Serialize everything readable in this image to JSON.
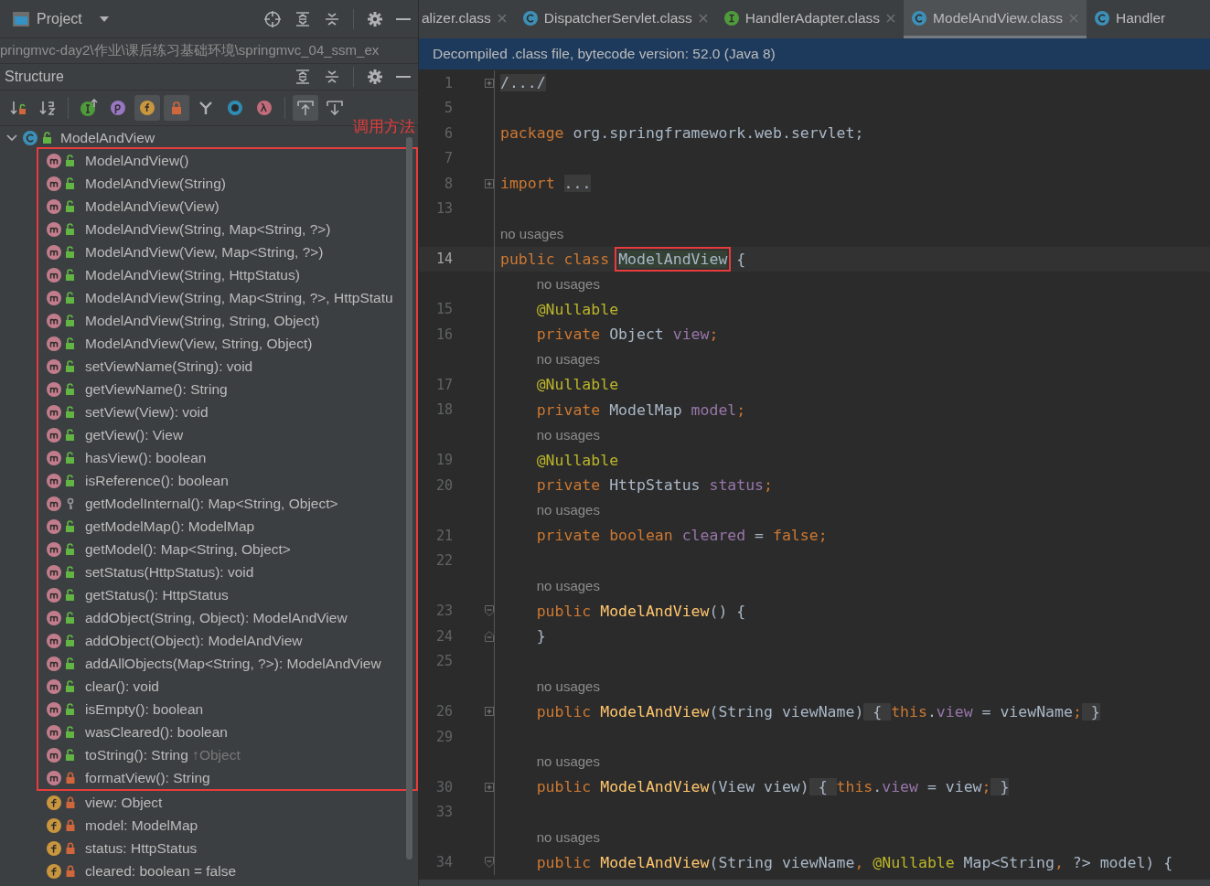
{
  "project_panel": {
    "title": "Project",
    "path": "pringmvc-day2\\作业\\课后练习基础环境\\springmvc_04_ssm_ex"
  },
  "structure_panel": {
    "title": "Structure",
    "toolbar": [
      {
        "kind": "sort-visibility",
        "on": false
      },
      {
        "kind": "sort-alpha",
        "on": false
      },
      {
        "kind": "sep"
      },
      {
        "kind": "inherited",
        "on": false
      },
      {
        "kind": "properties",
        "on": false
      },
      {
        "kind": "fields",
        "on": true
      },
      {
        "kind": "non-public",
        "on": true
      },
      {
        "kind": "fork",
        "on": false
      },
      {
        "kind": "anonymous",
        "on": false
      },
      {
        "kind": "lambdas",
        "on": false
      },
      {
        "kind": "sep"
      },
      {
        "kind": "expand-from",
        "on": true
      },
      {
        "kind": "expand-to",
        "on": false
      }
    ],
    "annotation": {
      "text": "调用方法",
      "kind": "methods"
    },
    "tree": {
      "label": "ModelAndView",
      "kind": "public-class",
      "expanded": true,
      "children": [
        {
          "label": "ModelAndView()",
          "kind": "public-method"
        },
        {
          "label": "ModelAndView(String)",
          "kind": "public-method"
        },
        {
          "label": "ModelAndView(View)",
          "kind": "public-method"
        },
        {
          "label": "ModelAndView(String, Map<String, ?>)",
          "kind": "public-method"
        },
        {
          "label": "ModelAndView(View, Map<String, ?>)",
          "kind": "public-method"
        },
        {
          "label": "ModelAndView(String, HttpStatus)",
          "kind": "public-method"
        },
        {
          "label": "ModelAndView(String, Map<String, ?>, HttpStatu",
          "kind": "public-method"
        },
        {
          "label": "ModelAndView(String, String, Object)",
          "kind": "public-method"
        },
        {
          "label": "ModelAndView(View, String, Object)",
          "kind": "public-method"
        },
        {
          "label": "setViewName(String): void",
          "kind": "public-method"
        },
        {
          "label": "getViewName(): String",
          "kind": "public-method"
        },
        {
          "label": "setView(View): void",
          "kind": "public-method"
        },
        {
          "label": "getView(): View",
          "kind": "public-method"
        },
        {
          "label": "hasView(): boolean",
          "kind": "public-method"
        },
        {
          "label": "isReference(): boolean",
          "kind": "public-method"
        },
        {
          "label": "getModelInternal(): Map<String, Object>",
          "kind": "package-method"
        },
        {
          "label": "getModelMap(): ModelMap",
          "kind": "public-method"
        },
        {
          "label": "getModel(): Map<String, Object>",
          "kind": "public-method"
        },
        {
          "label": "setStatus(HttpStatus): void",
          "kind": "public-method"
        },
        {
          "label": "getStatus(): HttpStatus",
          "kind": "public-method"
        },
        {
          "label": "addObject(String, Object): ModelAndView",
          "kind": "public-method"
        },
        {
          "label": "addObject(Object): ModelAndView",
          "kind": "public-method"
        },
        {
          "label": "addAllObjects(Map<String, ?>): ModelAndView",
          "kind": "public-method"
        },
        {
          "label": "clear(): void",
          "kind": "public-method"
        },
        {
          "label": "isEmpty(): boolean",
          "kind": "public-method"
        },
        {
          "label": "wasCleared(): boolean",
          "kind": "public-method"
        },
        {
          "label": "toString(): String",
          "origin": "↑Object",
          "kind": "public-method"
        },
        {
          "label": "formatView(): String",
          "kind": "private-method"
        },
        {
          "label": "view: Object",
          "kind": "private-field"
        },
        {
          "label": "model: ModelMap",
          "kind": "private-field"
        },
        {
          "label": "status: HttpStatus",
          "kind": "private-field"
        },
        {
          "label": "cleared: boolean = false",
          "kind": "private-field"
        }
      ]
    }
  },
  "editor": {
    "tabs": [
      {
        "label": "alizer.class",
        "selected": false,
        "closable": true
      },
      {
        "label": "DispatcherServlet.class",
        "kind": "class",
        "selected": false,
        "closable": true
      },
      {
        "label": "HandlerAdapter.class",
        "kind": "interface",
        "selected": false,
        "closable": true
      },
      {
        "label": "ModelAndView.class",
        "kind": "class",
        "selected": true,
        "closable": true
      },
      {
        "label": "Handler",
        "kind": "class",
        "selected": false,
        "closable": false
      }
    ],
    "banner": "Decompiled .class file, bytecode version: 52.0 (Java 8)",
    "lines": [
      {
        "number": "1",
        "kind": "collapsed",
        "tokens": [
          {
            "kind": "folded",
            "text": "/.../"
          }
        ]
      },
      {
        "number": "5"
      },
      {
        "number": "6",
        "tokens": [
          {
            "kind": "keyword",
            "text": "package "
          },
          {
            "kind": "plain",
            "text": "org.springframework.web.servlet;"
          }
        ]
      },
      {
        "number": "7"
      },
      {
        "number": "8",
        "kind": "collapsed",
        "tokens": [
          {
            "kind": "keyword",
            "text": "import "
          },
          {
            "kind": "folded",
            "text": "..."
          }
        ]
      },
      {
        "number": "13"
      },
      {
        "kind": "hint",
        "text": "no usages"
      },
      {
        "number": "14",
        "current": true,
        "tokens": [
          {
            "kind": "keyword",
            "text": "public class "
          },
          {
            "kind": "plain",
            "text": "ModelAndView",
            "boxed": true
          },
          {
            "kind": "plain",
            "text": " {"
          }
        ],
        "children": [
          {
            "kind": "hint",
            "text": "no usages"
          },
          {
            "number": "15",
            "tokens": [
              {
                "kind": "annotation",
                "text": "@Nullable"
              }
            ]
          },
          {
            "number": "16",
            "tokens": [
              {
                "kind": "keyword",
                "text": "private "
              },
              {
                "kind": "plain",
                "text": "Object "
              },
              {
                "kind": "field",
                "text": "view"
              },
              {
                "kind": "keyword",
                "text": ";"
              }
            ]
          },
          {
            "kind": "hint",
            "text": "no usages"
          },
          {
            "number": "17",
            "tokens": [
              {
                "kind": "annotation",
                "text": "@Nullable"
              }
            ]
          },
          {
            "number": "18",
            "tokens": [
              {
                "kind": "keyword",
                "text": "private "
              },
              {
                "kind": "plain",
                "text": "ModelMap "
              },
              {
                "kind": "field",
                "text": "model"
              },
              {
                "kind": "keyword",
                "text": ";"
              }
            ]
          },
          {
            "kind": "hint",
            "text": "no usages"
          },
          {
            "number": "19",
            "tokens": [
              {
                "kind": "annotation",
                "text": "@Nullable"
              }
            ]
          },
          {
            "number": "20",
            "tokens": [
              {
                "kind": "keyword",
                "text": "private "
              },
              {
                "kind": "plain",
                "text": "HttpStatus "
              },
              {
                "kind": "field",
                "text": "status"
              },
              {
                "kind": "keyword",
                "text": ";"
              }
            ]
          },
          {
            "kind": "hint",
            "text": "no usages"
          },
          {
            "number": "21",
            "tokens": [
              {
                "kind": "keyword",
                "text": "private boolean "
              },
              {
                "kind": "field",
                "text": "cleared"
              },
              {
                "kind": "plain",
                "text": " = "
              },
              {
                "kind": "keyword",
                "text": "false;"
              }
            ]
          },
          {
            "number": "22"
          },
          {
            "kind": "hint",
            "text": "no usages"
          },
          {
            "number": "23",
            "kind": "block-start",
            "tokens": [
              {
                "kind": "keyword",
                "text": "public "
              },
              {
                "kind": "method",
                "text": "ModelAndView"
              },
              {
                "kind": "plain",
                "text": "() {"
              }
            ]
          },
          {
            "number": "24",
            "kind": "block-end",
            "tokens": [
              {
                "kind": "plain",
                "text": "}"
              }
            ]
          },
          {
            "number": "25"
          },
          {
            "kind": "hint",
            "text": "no usages"
          },
          {
            "number": "26",
            "kind": "collapsed",
            "tokens": [
              {
                "kind": "keyword",
                "text": "public "
              },
              {
                "kind": "method",
                "text": "ModelAndView"
              },
              {
                "kind": "plain",
                "text": "(String viewName)"
              },
              {
                "kind": "folded",
                "text": " { "
              },
              {
                "kind": "keyword",
                "text": "this"
              },
              {
                "kind": "plain",
                "text": "."
              },
              {
                "kind": "field",
                "text": "view"
              },
              {
                "kind": "plain",
                "text": " = viewName"
              },
              {
                "kind": "keyword",
                "text": ";"
              },
              {
                "kind": "folded",
                "text": " }"
              }
            ]
          },
          {
            "number": "29"
          },
          {
            "kind": "hint",
            "text": "no usages"
          },
          {
            "number": "30",
            "kind": "collapsed",
            "tokens": [
              {
                "kind": "keyword",
                "text": "public "
              },
              {
                "kind": "method",
                "text": "ModelAndView"
              },
              {
                "kind": "plain",
                "text": "(View view)"
              },
              {
                "kind": "folded",
                "text": " { "
              },
              {
                "kind": "keyword",
                "text": "this"
              },
              {
                "kind": "plain",
                "text": "."
              },
              {
                "kind": "field",
                "text": "view"
              },
              {
                "kind": "plain",
                "text": " = view"
              },
              {
                "kind": "keyword",
                "text": ";"
              },
              {
                "kind": "folded",
                "text": " }"
              }
            ]
          },
          {
            "number": "33"
          },
          {
            "kind": "hint",
            "text": "no usages"
          },
          {
            "number": "34",
            "kind": "block-start",
            "tokens": [
              {
                "kind": "keyword",
                "text": "public "
              },
              {
                "kind": "method",
                "text": "ModelAndView"
              },
              {
                "kind": "plain",
                "text": "(String viewName"
              },
              {
                "kind": "keyword",
                "text": ", "
              },
              {
                "kind": "annotation",
                "text": "@Nullable"
              },
              {
                "kind": "plain",
                "text": " Map<String"
              },
              {
                "kind": "keyword",
                "text": ", "
              },
              {
                "kind": "plain",
                "text": "?> model) {"
              }
            ]
          }
        ]
      }
    ]
  }
}
